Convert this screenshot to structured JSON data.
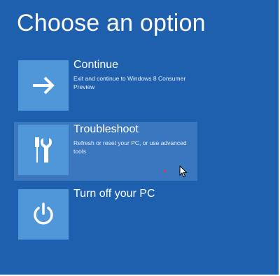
{
  "screen": {
    "title": "Choose an option"
  },
  "options": [
    {
      "label": "Continue",
      "description": "Exit and continue to Windows 8 Consumer Preview",
      "icon": "arrow-right-icon"
    },
    {
      "label": "Troubleshoot",
      "description": "Refresh or reset your PC, or use advanced tools",
      "icon": "tools-icon"
    },
    {
      "label": "Turn off your PC",
      "description": "",
      "icon": "power-icon"
    }
  ],
  "colors": {
    "background": "#1e5fae",
    "tile": "#4f97d9",
    "highlight": "#3a77bf",
    "text": "#ffffff"
  }
}
